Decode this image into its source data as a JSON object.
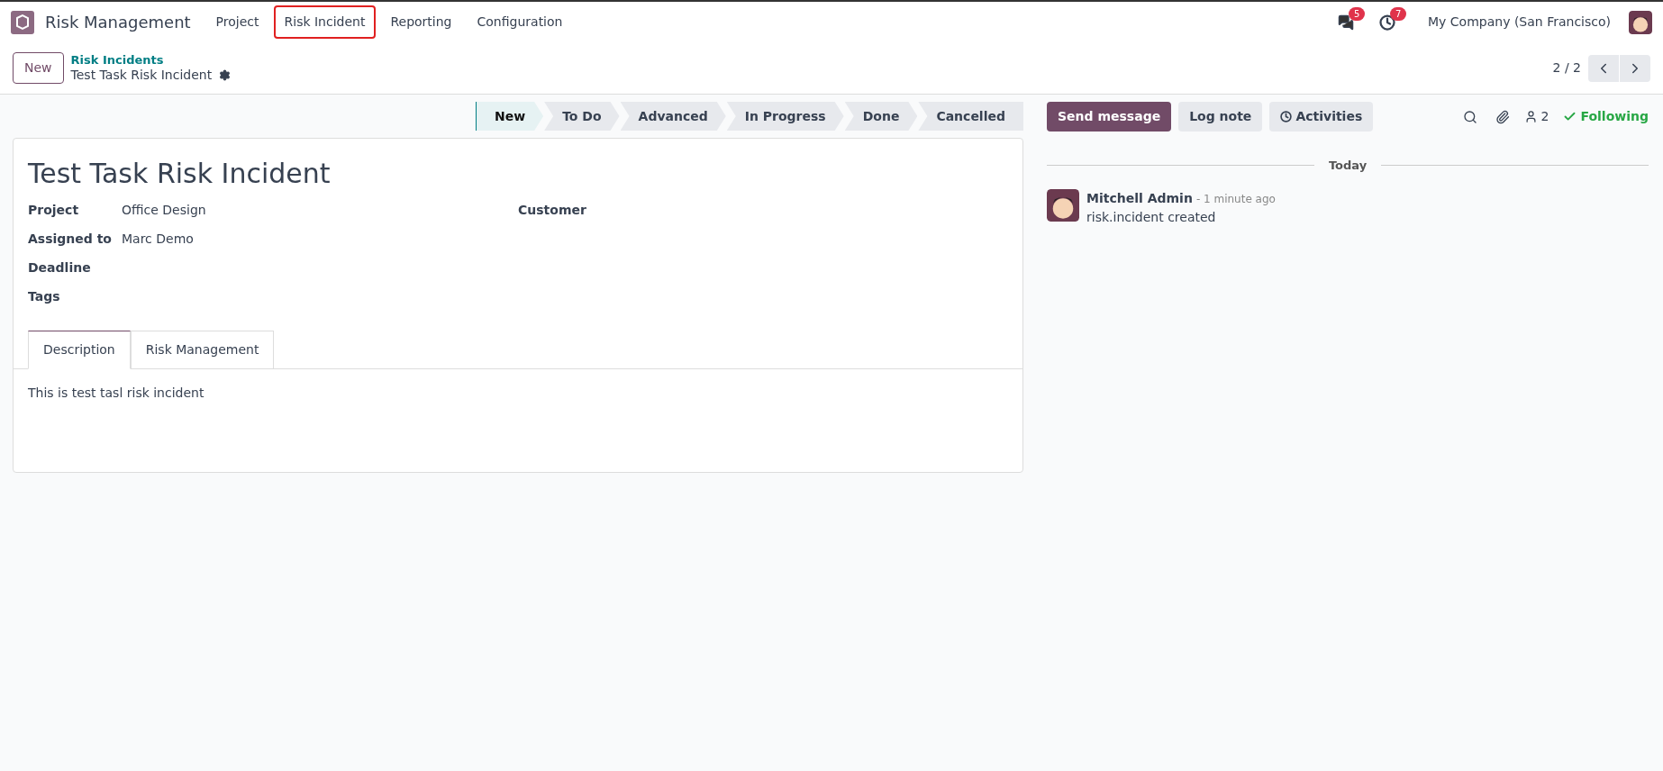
{
  "navbar": {
    "app_name": "Risk Management",
    "menu": [
      {
        "label": "Project",
        "selected": false
      },
      {
        "label": "Risk Incident",
        "selected": true
      },
      {
        "label": "Reporting",
        "selected": false
      },
      {
        "label": "Configuration",
        "selected": false
      }
    ],
    "messages_count": "5",
    "activities_count": "7",
    "company": "My Company (San Francisco)"
  },
  "control_panel": {
    "new_button": "New",
    "breadcrumb": "Risk Incidents",
    "record_title": "Test Task Risk Incident",
    "pager": "2 / 2"
  },
  "statusbar": [
    {
      "label": "New",
      "selected": true
    },
    {
      "label": "To Do",
      "selected": false
    },
    {
      "label": "Advanced",
      "selected": false
    },
    {
      "label": "In Progress",
      "selected": false
    },
    {
      "label": "Done",
      "selected": false
    },
    {
      "label": "Cancelled",
      "selected": false
    }
  ],
  "form": {
    "title": "Test Task Risk Incident",
    "left_fields": [
      {
        "label": "Project",
        "value": "Office Design"
      },
      {
        "label": "Assigned to",
        "value": "Marc Demo"
      },
      {
        "label": "Deadline"
      },
      {
        "label": "Tags"
      }
    ],
    "right_fields": [
      {
        "label": "Customer"
      }
    ],
    "tabs": [
      {
        "label": "Description",
        "selected": true
      },
      {
        "label": "Risk Management",
        "selected": false
      }
    ],
    "description": "This is test tasl risk incident"
  },
  "chatter": {
    "buttons": [
      {
        "label": "Send message",
        "kind": "primary"
      },
      {
        "label": "Log note",
        "kind": "secondary"
      },
      {
        "label": "Activities",
        "kind": "activities"
      }
    ],
    "followers_count": "2",
    "following": "Following",
    "date_separator": "Today",
    "messages": [
      {
        "author": "Mitchell Admin",
        "time": "- 1 minute ago",
        "body": "risk.incident created"
      }
    ]
  }
}
